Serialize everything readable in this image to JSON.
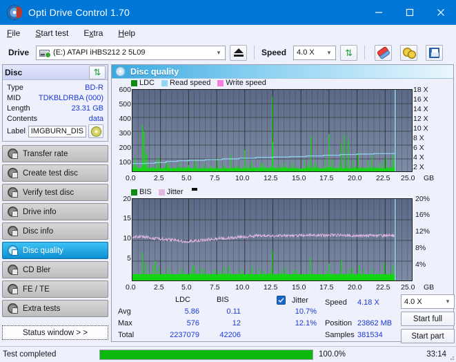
{
  "window": {
    "title": "Opti Drive Control 1.70",
    "icon": "disc-icon",
    "minimize": "minimize-icon",
    "maximize": "maximize-icon",
    "close": "close-icon"
  },
  "menu": {
    "items": [
      {
        "label": "File"
      },
      {
        "label": "Start test"
      },
      {
        "label": "Extra"
      },
      {
        "label": "Help"
      }
    ]
  },
  "toolbar": {
    "drive_label": "Drive",
    "drive_value": "(E:)   ATAPI iHBS212   2 5L09",
    "eject_icon": "eject-icon",
    "speed_label": "Speed",
    "speed_value": "4.0 X",
    "refresh_icon": "refresh-icon",
    "erase_icon": "eraser-icon",
    "settings_icon": "gears-icon",
    "save_icon": "floppy-save-icon"
  },
  "disc_panel": {
    "title": "Disc",
    "refresh_icon": "refresh-icon",
    "rows": [
      {
        "key": "Type",
        "value": "BD-R"
      },
      {
        "key": "MID",
        "value": "TDKBLDRBA (000)"
      },
      {
        "key": "Length",
        "value": "23.31 GB"
      },
      {
        "key": "Contents",
        "value": "data"
      }
    ],
    "label_key": "Label",
    "label_value": "IMGBURN_DIS",
    "label_icon": "cd-icon"
  },
  "sidebar": {
    "items": [
      {
        "label": "Transfer rate",
        "selected": false
      },
      {
        "label": "Create test disc",
        "selected": false
      },
      {
        "label": "Verify test disc",
        "selected": false
      },
      {
        "label": "Drive info",
        "selected": false
      },
      {
        "label": "Disc info",
        "selected": false
      },
      {
        "label": "Disc quality",
        "selected": true
      },
      {
        "label": "CD Bler",
        "selected": false
      },
      {
        "label": "FE / TE",
        "selected": false
      },
      {
        "label": "Extra tests",
        "selected": false
      }
    ],
    "status_window_button": "Status window > >"
  },
  "panel": {
    "title": "Disc quality",
    "icon": "disc-quality-icon"
  },
  "stats": {
    "col_ldc": "LDC",
    "col_bis": "BIS",
    "row_avg": "Avg",
    "row_max": "Max",
    "row_total": "Total",
    "ldc_avg": "5.86",
    "ldc_max": "576",
    "ldc_total": "2237079",
    "bis_avg": "0.11",
    "bis_max": "12",
    "bis_total": "42206",
    "jitter_label": "Jitter",
    "jitter_checked": true,
    "jitter_avg": "10.7%",
    "jitter_max": "12.1%",
    "speed_label": "Speed",
    "speed_value": "4.18 X",
    "position_label": "Position",
    "position_value": "23862 MB",
    "samples_label": "Samples",
    "samples_value": "381534",
    "speed_select": "4.0 X",
    "start_full": "Start full",
    "start_part": "Start part"
  },
  "statusbar": {
    "message": "Test completed",
    "progress_percent": "100.0%",
    "progress_value": 100,
    "elapsed": "33:14"
  },
  "colors": {
    "accent": "#0076d7",
    "ldc_green": "#14d414",
    "read_speed_blue": "#8fd8f5",
    "write_speed_pink": "#f57ddb",
    "jitter_pink": "#e0b8e0",
    "plot_bg_top": "#5a6a86",
    "plot_bg_bottom": "#7e8ca6",
    "value_blue": "#1a38d8",
    "progress_green": "#0bb80b"
  },
  "chart_data": [
    {
      "type": "line",
      "id": "ldc-chart",
      "title": "",
      "legend": [
        {
          "label": "LDC",
          "color": "#14d414"
        },
        {
          "label": "Read speed",
          "color": "#8fd8f5"
        },
        {
          "label": "Write speed",
          "color": "#f57ddb"
        }
      ],
      "legend_position": "top-left",
      "xlabel": "GB",
      "xlim": [
        0,
        25
      ],
      "xticks": [
        "0.0",
        "2.5",
        "5.0",
        "7.5",
        "10.0",
        "12.5",
        "15.0",
        "17.5",
        "20.0",
        "22.5",
        "25.0"
      ],
      "ylabel_left": "",
      "ylim": [
        0,
        600
      ],
      "yticks_left": [
        "100",
        "200",
        "300",
        "400",
        "500",
        "600"
      ],
      "ylabel_right": "X",
      "ylim_right": [
        0,
        18
      ],
      "yticks_right": [
        "2 X",
        "4 X",
        "6 X",
        "8 X",
        "10 X",
        "12 X",
        "14 X",
        "16 X",
        "18 X"
      ],
      "grid": true,
      "series": [
        {
          "name": "LDC",
          "color": "#14d414",
          "kind": "spikes",
          "note": "dense green error spikes across 0-23.4 GB, baseline ~10-40, notable peaks",
          "peaks": [
            {
              "x": 0.9,
              "y": 345
            },
            {
              "x": 1.0,
              "y": 300
            },
            {
              "x": 1.15,
              "y": 155
            },
            {
              "x": 1.3,
              "y": 130
            },
            {
              "x": 2.2,
              "y": 95
            },
            {
              "x": 2.35,
              "y": 110
            },
            {
              "x": 3.1,
              "y": 60
            },
            {
              "x": 4.2,
              "y": 70
            },
            {
              "x": 5.0,
              "y": 55
            },
            {
              "x": 5.6,
              "y": 85
            },
            {
              "x": 6.4,
              "y": 60
            },
            {
              "x": 7.0,
              "y": 50
            },
            {
              "x": 7.6,
              "y": 105
            },
            {
              "x": 8.1,
              "y": 60
            },
            {
              "x": 8.8,
              "y": 130
            },
            {
              "x": 9.4,
              "y": 55
            },
            {
              "x": 10.0,
              "y": 165
            },
            {
              "x": 10.6,
              "y": 75
            },
            {
              "x": 11.5,
              "y": 70
            },
            {
              "x": 12.45,
              "y": 550
            },
            {
              "x": 12.5,
              "y": 225
            },
            {
              "x": 13.1,
              "y": 60
            },
            {
              "x": 14.3,
              "y": 75
            },
            {
              "x": 15.9,
              "y": 265
            },
            {
              "x": 16.3,
              "y": 70
            },
            {
              "x": 17.5,
              "y": 280
            },
            {
              "x": 17.8,
              "y": 95
            },
            {
              "x": 18.6,
              "y": 215
            },
            {
              "x": 18.9,
              "y": 280
            },
            {
              "x": 19.2,
              "y": 240
            },
            {
              "x": 20.1,
              "y": 145
            },
            {
              "x": 21.0,
              "y": 90
            },
            {
              "x": 22.0,
              "y": 70
            },
            {
              "x": 22.6,
              "y": 110
            },
            {
              "x": 23.2,
              "y": 130
            }
          ]
        },
        {
          "name": "Read speed",
          "color": "#8fd8f5",
          "kind": "step-line",
          "note": "rises from ~2.0X at 0 GB to ~4.2X at 23.4 GB, then vertical jump at end of data",
          "points": [
            {
              "x": 0.0,
              "y": 2.0
            },
            {
              "x": 1.2,
              "y": 2.05
            },
            {
              "x": 2.0,
              "y": 2.2
            },
            {
              "x": 3.0,
              "y": 2.45
            },
            {
              "x": 4.0,
              "y": 2.6
            },
            {
              "x": 5.0,
              "y": 2.7
            },
            {
              "x": 6.5,
              "y": 2.85
            },
            {
              "x": 8.0,
              "y": 3.0
            },
            {
              "x": 9.5,
              "y": 3.15
            },
            {
              "x": 11.0,
              "y": 3.3
            },
            {
              "x": 12.5,
              "y": 3.4
            },
            {
              "x": 14.0,
              "y": 3.5
            },
            {
              "x": 15.5,
              "y": 3.65
            },
            {
              "x": 17.0,
              "y": 3.8
            },
            {
              "x": 18.5,
              "y": 3.95
            },
            {
              "x": 20.0,
              "y": 4.05
            },
            {
              "x": 21.5,
              "y": 4.15
            },
            {
              "x": 23.3,
              "y": 4.2
            },
            {
              "x": 23.4,
              "y": 18.0
            }
          ]
        },
        {
          "name": "Write speed",
          "color": "#f57ddb",
          "kind": "line",
          "points": []
        }
      ]
    },
    {
      "type": "line",
      "id": "bis-chart",
      "title": "",
      "legend": [
        {
          "label": "BIS",
          "color": "#14d414"
        },
        {
          "label": "Jitter",
          "color": "#e0b8e0"
        }
      ],
      "legend_position": "top-left",
      "xlabel": "GB",
      "xlim": [
        0,
        25
      ],
      "xticks": [
        "0.0",
        "2.5",
        "5.0",
        "7.5",
        "10.0",
        "12.5",
        "15.0",
        "17.5",
        "20.0",
        "22.5",
        "25.0"
      ],
      "ylim": [
        0,
        20
      ],
      "yticks_left": [
        "5",
        "10",
        "15",
        "20"
      ],
      "ylim_right": [
        0,
        20
      ],
      "yticks_right": [
        "4%",
        "8%",
        "12%",
        "16%",
        "20%"
      ],
      "grid": true,
      "series": [
        {
          "name": "BIS",
          "color": "#14d414",
          "kind": "spikes",
          "note": "dense green baseline ~1.5, scattered spikes to 2-7",
          "peaks": [
            {
              "x": 0.95,
              "y": 7.0
            },
            {
              "x": 1.2,
              "y": 4.6
            },
            {
              "x": 2.0,
              "y": 5.0
            },
            {
              "x": 2.35,
              "y": 3.6
            },
            {
              "x": 3.2,
              "y": 3.4
            },
            {
              "x": 4.3,
              "y": 3.2
            },
            {
              "x": 5.4,
              "y": 3.8
            },
            {
              "x": 6.4,
              "y": 3.1
            },
            {
              "x": 7.3,
              "y": 3.0
            },
            {
              "x": 8.2,
              "y": 3.6
            },
            {
              "x": 8.6,
              "y": 3.7
            },
            {
              "x": 9.6,
              "y": 3.2
            },
            {
              "x": 10.6,
              "y": 3.8
            },
            {
              "x": 11.4,
              "y": 3.2
            },
            {
              "x": 12.45,
              "y": 7.6
            },
            {
              "x": 13.6,
              "y": 3.4
            },
            {
              "x": 14.6,
              "y": 3.0
            },
            {
              "x": 15.85,
              "y": 5.8
            },
            {
              "x": 17.5,
              "y": 4.4
            },
            {
              "x": 18.6,
              "y": 5.2
            },
            {
              "x": 19.6,
              "y": 3.4
            },
            {
              "x": 20.2,
              "y": 4.0
            },
            {
              "x": 21.3,
              "y": 3.2
            },
            {
              "x": 22.4,
              "y": 4.6
            },
            {
              "x": 23.2,
              "y": 4.0
            }
          ]
        },
        {
          "name": "Jitter",
          "color": "#e0b8e0",
          "kind": "noisy-line",
          "note": "oscillates around 10-11.5% across the disc; dips to ~9.5% near 4-5 GB",
          "points": [
            {
              "x": 0.0,
              "y": 10.8
            },
            {
              "x": 1.0,
              "y": 10.9
            },
            {
              "x": 2.0,
              "y": 10.5
            },
            {
              "x": 3.0,
              "y": 10.2
            },
            {
              "x": 4.0,
              "y": 10.1
            },
            {
              "x": 4.6,
              "y": 9.6
            },
            {
              "x": 5.4,
              "y": 9.9
            },
            {
              "x": 6.2,
              "y": 10.0
            },
            {
              "x": 7.0,
              "y": 10.3
            },
            {
              "x": 8.0,
              "y": 10.5
            },
            {
              "x": 9.0,
              "y": 10.7
            },
            {
              "x": 10.0,
              "y": 10.9
            },
            {
              "x": 11.0,
              "y": 11.1
            },
            {
              "x": 12.0,
              "y": 11.2
            },
            {
              "x": 13.0,
              "y": 11.1
            },
            {
              "x": 14.0,
              "y": 11.2
            },
            {
              "x": 15.0,
              "y": 11.2
            },
            {
              "x": 16.0,
              "y": 11.3
            },
            {
              "x": 17.0,
              "y": 11.2
            },
            {
              "x": 18.0,
              "y": 11.3
            },
            {
              "x": 19.0,
              "y": 11.2
            },
            {
              "x": 20.0,
              "y": 11.1
            },
            {
              "x": 21.0,
              "y": 11.2
            },
            {
              "x": 22.0,
              "y": 11.1
            },
            {
              "x": 23.3,
              "y": 11.2
            }
          ]
        },
        {
          "name": "Read speed marker",
          "color": "#8fd8f5",
          "kind": "vline",
          "points": [
            {
              "x": 23.4,
              "y": 20
            }
          ]
        }
      ]
    }
  ]
}
